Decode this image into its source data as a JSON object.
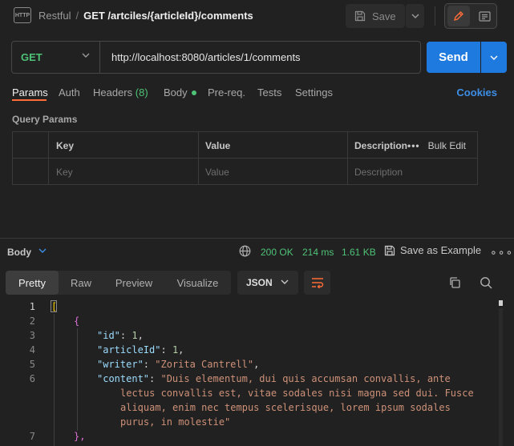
{
  "header": {
    "breadcrumb_parent": "Restful",
    "breadcrumb_separator": "/",
    "request_title": "GET /artciles/{articleId}/comments",
    "save_label": "Save"
  },
  "request": {
    "method": "GET",
    "url": "http://localhost:8080/articles/1/comments",
    "send_label": "Send",
    "tabs": {
      "params": "Params",
      "auth": "Auth",
      "headers": "Headers",
      "headers_count": "(8)",
      "body": "Body",
      "prereq": "Pre-req.",
      "tests": "Tests",
      "settings": "Settings"
    },
    "cookies_label": "Cookies"
  },
  "query_params": {
    "title": "Query Params",
    "columns": {
      "key": "Key",
      "value": "Value",
      "description": "Description"
    },
    "bulk_edit_label": "Bulk Edit",
    "placeholders": {
      "key": "Key",
      "value": "Value",
      "description": "Description"
    }
  },
  "response": {
    "body_label": "Body",
    "status": "200 OK",
    "time": "214 ms",
    "size": "1.61 KB",
    "save_example_label": "Save as Example",
    "view_tabs": [
      "Pretty",
      "Raw",
      "Preview",
      "Visualize"
    ],
    "format": "JSON"
  },
  "code": {
    "line_numbers": [
      "1",
      "2",
      "3",
      "4",
      "5",
      "6",
      "7"
    ],
    "open_bracket": "[",
    "open_brace": "{",
    "close_brace_comma": "},",
    "colon": ": ",
    "comma": ",",
    "fields": {
      "id_key": "\"id\"",
      "id_value": "1",
      "articleId_key": "\"articleId\"",
      "articleId_value": "1",
      "writer_key": "\"writer\"",
      "writer_value": "\"Zorita Cantrell\"",
      "content_key": "\"content\"",
      "content_lines": [
        "\"Duis elementum, dui quis accumsan convallis, ante",
        "lectus convallis est, vitae sodales nisi magna sed dui. Fusce",
        "aliquam, enim nec tempus scelerisque, lorem ipsum sodales",
        "purus, in molestie\""
      ]
    }
  },
  "icons": {
    "http": "http-file-icon",
    "save": "save-icon",
    "edit": "pencil-icon",
    "doc": "documentation-icon",
    "globe": "globe-icon",
    "copy": "copy-icon",
    "search": "search-icon",
    "wrap": "wrap-lines-icon"
  },
  "colors": {
    "accent": "#ff6c37",
    "send": "#1f7ae0",
    "success": "#4ec277",
    "link": "#3d8ee6"
  }
}
